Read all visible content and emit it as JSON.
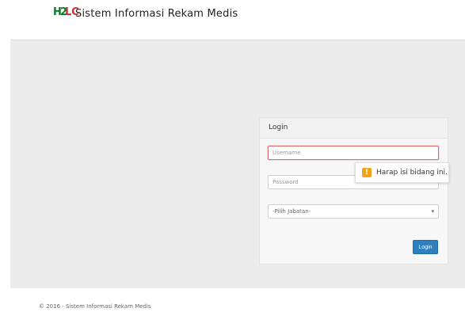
{
  "header": {
    "brand_h": "H",
    "brand_2": "2",
    "brand_lc": "LC",
    "title": "Sistem Informasi Rekam Medis"
  },
  "login": {
    "title": "Login",
    "username_placeholder": "Username",
    "password_placeholder": "Password",
    "jabatan_selected": "-Pilih Jabatan-",
    "button": "Login"
  },
  "tooltip": {
    "text": "Harap isi bidang ini.",
    "icon": "warning-icon",
    "color": "#f2a31b"
  },
  "footer": {
    "text": "© 2016 - Sistem Informasi Rekam Medis"
  },
  "colors": {
    "accent": "#2d7fbf",
    "logo_green": "#0a7a2c",
    "logo_red": "#d32f2f"
  }
}
